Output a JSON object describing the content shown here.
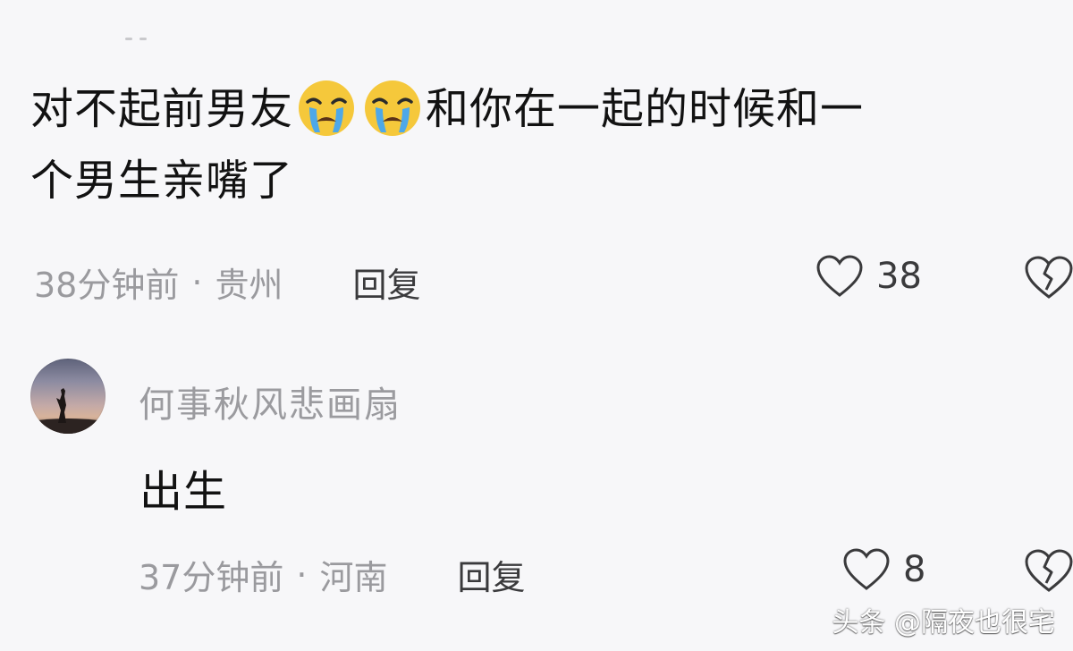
{
  "comments": [
    {
      "text_part1": "对不起前男友",
      "text_part2": "和你在一起的时候和一",
      "text_line2": "个男生亲嘴了",
      "emoji": "loudly-crying-face",
      "emoji_count": 2,
      "time": "38分钟前",
      "dot": "·",
      "location": "贵州",
      "reply_label": "回复",
      "likes": "38"
    },
    {
      "username": "何事秋风悲画扇",
      "text": "出生",
      "time": "37分钟前",
      "dot": "·",
      "location": "河南",
      "reply_label": "回复",
      "likes": "8"
    }
  ],
  "icons": {
    "like": "heart-outline-icon",
    "dislike": "broken-heart-icon"
  },
  "watermark": "头条 @隔夜也很宅",
  "colors": {
    "background": "#f7f7f9",
    "primary_text": "#121212",
    "secondary_text": "#9a9a9e",
    "emoji_yellow": "#f5c83b",
    "emoji_tears": "#4ea8e8"
  }
}
